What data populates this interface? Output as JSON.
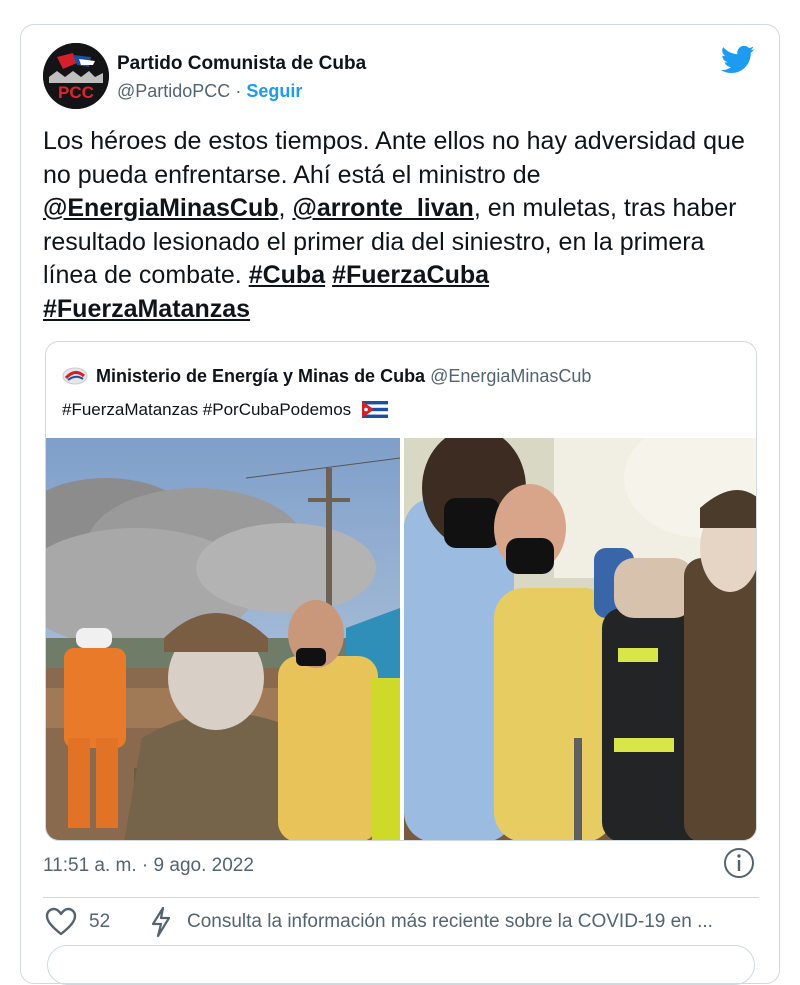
{
  "author": {
    "name": "Partido Comunista de Cuba",
    "handle": "@PartidoPCC",
    "separator": "·",
    "follow_label": "Seguir",
    "avatar_text": "PCC"
  },
  "tweet": {
    "text_parts": [
      "Los héroes de estos tiempos. Ante ellos no hay adversidad que no pueda enfrentarse. Ahí está el ministro de ",
      "@EnergiaMinasCub",
      ", ",
      "@arronte_livan",
      ", en muletas, tras haber resultado lesionado el primer dia del siniestro, en la primera línea de combate. ",
      "#Cuba",
      " ",
      "#FuerzaCuba",
      " ",
      "#FuerzaMatanzas"
    ]
  },
  "quote": {
    "name": "Ministerio de Energía y Minas de Cuba",
    "handle": "@EnergiaMinasCub",
    "text": "#FuerzaMatanzas #PorCubaPodemos"
  },
  "footer": {
    "timestamp": "11:51 a. m. · 9 ago. 2022",
    "like_count": "52",
    "covid_text": "Consulta la información más reciente sobre la COVID-19 en ..."
  },
  "colors": {
    "accent": "#1d9bf0",
    "text": "#0f1419",
    "muted": "#536471",
    "border": "#cfd9de"
  },
  "icons": [
    "twitter-bird-icon",
    "info-icon",
    "heart-icon",
    "lightning-bolt-icon",
    "cuba-flag-icon"
  ]
}
